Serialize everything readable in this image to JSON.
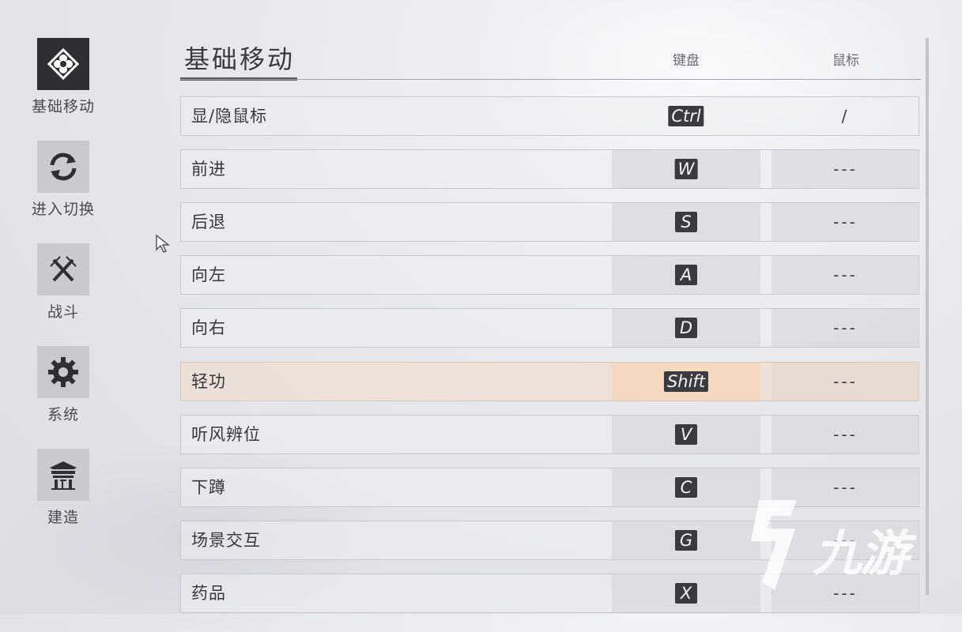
{
  "sidebar": {
    "items": [
      {
        "label": "基础移动",
        "icon": "diamond-flower-icon",
        "active": true
      },
      {
        "label": "进入切换",
        "icon": "swap-arrows-icon",
        "active": false
      },
      {
        "label": "战斗",
        "icon": "crossed-swords-icon",
        "active": false
      },
      {
        "label": "系统",
        "icon": "gear-icon",
        "active": false
      },
      {
        "label": "建造",
        "icon": "pavilion-icon",
        "active": false
      }
    ]
  },
  "header": {
    "title": "基础移动",
    "col_keyboard": "键盘",
    "col_mouse": "鼠标"
  },
  "rows": [
    {
      "action": "显/隐鼠标",
      "key": "Ctrl",
      "mouse": "/"
    },
    {
      "action": "前进",
      "key": "W",
      "mouse": "---"
    },
    {
      "action": "后退",
      "key": "S",
      "mouse": "---"
    },
    {
      "action": "向左",
      "key": "A",
      "mouse": "---"
    },
    {
      "action": "向右",
      "key": "D",
      "mouse": "---"
    },
    {
      "action": "轻功",
      "key": "Shift",
      "mouse": "---",
      "highlighted": true
    },
    {
      "action": "听风辨位",
      "key": "V",
      "mouse": "---"
    },
    {
      "action": "下蹲",
      "key": "C",
      "mouse": "---"
    },
    {
      "action": "场景交互",
      "key": "G",
      "mouse": "---"
    },
    {
      "action": "药品",
      "key": "X",
      "mouse": "---"
    }
  ],
  "watermark": {
    "text": "九游",
    "icon": "jiuyou-logo-icon"
  },
  "colors": {
    "active_nav": "#2e2f33",
    "highlight_row": "#eeded0",
    "keycap": "#3a3b40"
  }
}
